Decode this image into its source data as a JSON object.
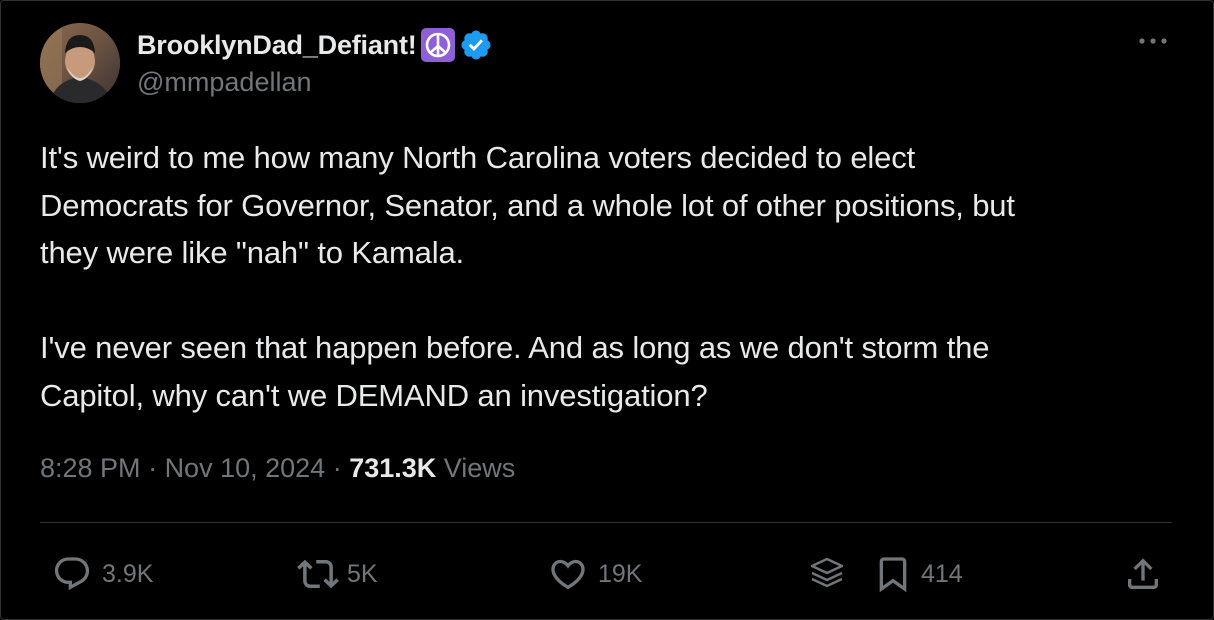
{
  "user": {
    "display_name": "BrooklynDad_Defiant!",
    "peace_emoji": "☮",
    "handle": "@mmpadellan",
    "verified": true
  },
  "tweet": {
    "text": "It's weird to me how many North Carolina voters decided to elect\nDemocrats for Governor, Senator, and a whole lot of other positions, but\nthey were like \"nah\" to Kamala.\n\nI've never seen that happen before. And as long as we don't storm the\nCapitol, why can't we DEMAND an investigation?"
  },
  "meta": {
    "time": "8:28 PM",
    "separator": " · ",
    "date": "Nov 10, 2024",
    "separator2": " · ",
    "views_count": "731.3K",
    "views_label": " Views"
  },
  "actions": {
    "replies": "3.9K",
    "reposts": "5K",
    "likes": "19K",
    "bookmarks": "414"
  },
  "colors": {
    "background": "#000000",
    "text": "#e7e9ea",
    "muted": "#71767b",
    "verified_blue": "#1d9bf0",
    "peace_purple": "#8e5fd6",
    "divider": "#2f3336"
  },
  "icons": {
    "more": "more-horizontal-icon",
    "reply": "reply-icon",
    "repost": "repost-icon",
    "like": "heart-icon",
    "grok": "grok-layers-icon",
    "bookmark": "bookmark-icon",
    "share": "share-icon"
  }
}
